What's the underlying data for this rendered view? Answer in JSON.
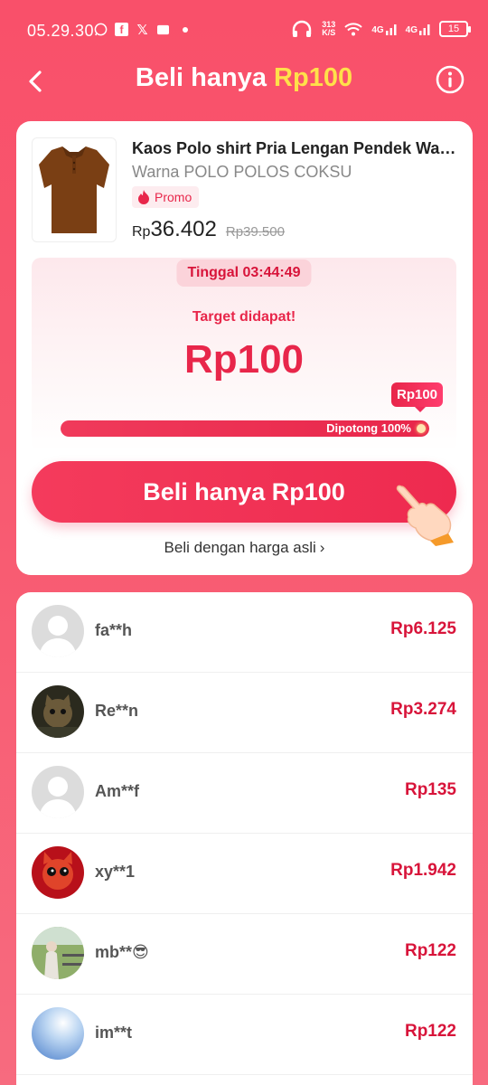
{
  "status": {
    "time": "05.29.30",
    "speed_top": "313",
    "speed_unit": "K/S",
    "network1": "4G",
    "network2": "4G",
    "battery": "15"
  },
  "header": {
    "title_prefix": "Beli hanya ",
    "title_accent": "Rp100"
  },
  "product": {
    "name": "Kaos Polo shirt Pria Lengan Pendek Warna",
    "variant": "Warna POLO POLOS COKSU",
    "promo_label": "Promo",
    "price_currency": "Rp",
    "price_now": "36.402",
    "price_old": "Rp39.500"
  },
  "target": {
    "timer": "Tinggal 03:44:49",
    "label": "Target didapat!",
    "amount": "Rp100",
    "bubble": "Rp100",
    "progress_text": "Dipotong 100%",
    "progress_percent": 100
  },
  "actions": {
    "buy_label": "Beli hanya Rp100",
    "normal_price_label": "Beli dengan harga asli",
    "normal_price_chevron": "›"
  },
  "helpers": [
    {
      "name": "fa**h",
      "amount": "Rp6.125",
      "avatar": "default"
    },
    {
      "name": "Re**n",
      "amount": "Rp3.274",
      "avatar": "cat-dark"
    },
    {
      "name": "Am**f",
      "amount": "Rp135",
      "avatar": "default"
    },
    {
      "name": "xy**1",
      "amount": "Rp1.942",
      "avatar": "cat-red"
    },
    {
      "name": "mb**😎",
      "amount": "Rp122",
      "avatar": "person-outdoor"
    },
    {
      "name": "im**t",
      "amount": "Rp122",
      "avatar": "sky"
    }
  ],
  "colors": {
    "background": "#f9506a",
    "accent_red": "#e8264a",
    "accent_yellow": "#ffe04a",
    "amount_red": "#d8143a"
  }
}
